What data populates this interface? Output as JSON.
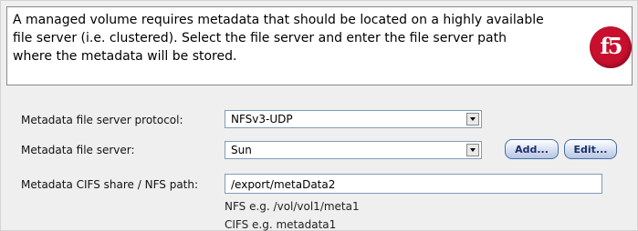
{
  "header": {
    "description_line1": "A managed volume requires metadata that should be located on a highly available",
    "description_line2": "file server (i.e. clustered). Select the file server and enter the file server path",
    "description_line3": "where the metadata will be stored.",
    "logo_text": "f5"
  },
  "form": {
    "protocol": {
      "label": "Metadata file server protocol:",
      "value": "NFSv3-UDP"
    },
    "server": {
      "label": "Metadata file server:",
      "value": "Sun"
    },
    "path": {
      "label": "Metadata CIFS share / NFS path:",
      "value": "/export/metaData2"
    },
    "add_button": "Add...",
    "edit_button": "Edit...",
    "hint_nfs": "NFS e.g. /vol/vol1/meta1",
    "hint_cifs": "CIFS e.g. metadata1"
  },
  "colors": {
    "logo_red": "#c8102e",
    "button_text": "#1b2f6a",
    "panel_background": "#efefef"
  }
}
